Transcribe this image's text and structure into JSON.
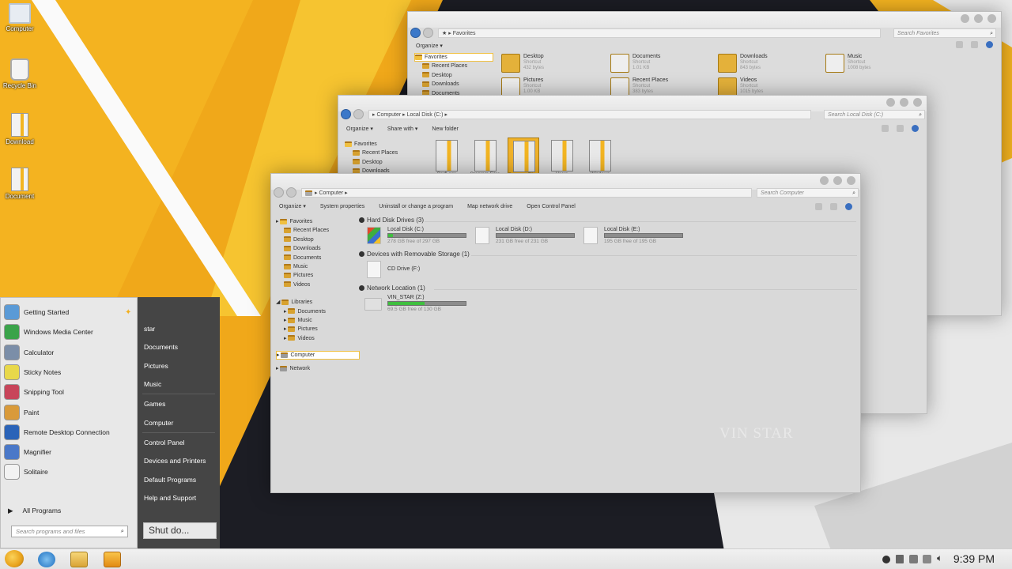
{
  "desktop_icons": [
    {
      "label": "Computer",
      "icon": "computer-icon"
    },
    {
      "label": "Recycle Bin",
      "icon": "recycle-bin-icon"
    },
    {
      "label": "Download",
      "icon": "folder-icon"
    },
    {
      "label": "Document",
      "icon": "folder-shortcut-icon"
    }
  ],
  "win_favorites": {
    "address": "Favorites",
    "search_placeholder": "Search Favorites",
    "toolbar": {
      "organize": "Organize"
    },
    "nav": [
      "Favorites",
      "Recent Places",
      "Desktop",
      "Downloads",
      "Documents"
    ],
    "items": [
      {
        "name": "Desktop",
        "type": "Shortcut",
        "size": "432 bytes"
      },
      {
        "name": "Documents",
        "type": "Shortcut",
        "size": "1.01 KB"
      },
      {
        "name": "Downloads",
        "type": "Shortcut",
        "size": "843 bytes"
      },
      {
        "name": "Music",
        "type": "Shortcut",
        "size": "1008 bytes"
      },
      {
        "name": "Pictures",
        "type": "Shortcut",
        "size": "1.00 KB"
      },
      {
        "name": "Recent Places",
        "type": "Shortcut",
        "size": "383 bytes"
      },
      {
        "name": "Videos",
        "type": "Shortcut",
        "size": "1015 bytes"
      }
    ]
  },
  "win_c": {
    "address": [
      "Computer",
      "Local Disk (C:)"
    ],
    "search_placeholder": "Search Local Disk (C:)",
    "toolbar": {
      "organize": "Organize",
      "share": "Share with",
      "new_folder": "New folder"
    },
    "nav": [
      "Favorites",
      "Recent Places",
      "Desktop",
      "Downloads"
    ],
    "folders": [
      "PerfLogs",
      "Program Files",
      "Program Files (x86)",
      "Users",
      "Windows"
    ]
  },
  "win_computer": {
    "address": "Computer",
    "search_placeholder": "Search Computer",
    "toolbar": {
      "organize": "Organize",
      "system_properties": "System properties",
      "uninstall": "Uninstall or change a program",
      "map_drive": "Map network drive",
      "control_panel": "Open Control Panel"
    },
    "nav_favorites": "Favorites",
    "nav_fav_items": [
      "Recent Places",
      "Desktop",
      "Downloads",
      "Documents",
      "Music",
      "Pictures",
      "Videos"
    ],
    "nav_libraries": "Libraries",
    "nav_lib_items": [
      "Documents",
      "Music",
      "Pictures",
      "Videos"
    ],
    "nav_computer": "Computer",
    "nav_network": "Network",
    "sections": {
      "hdd": "Hard Disk Drives (3)",
      "removable": "Devices with Removable Storage (1)",
      "network": "Network Location (1)"
    },
    "drives": [
      {
        "name": "Local Disk (C:)",
        "free": "278 GB free of 297 GB",
        "used_fraction": 0.06
      },
      {
        "name": "Local Disk (D:)",
        "free": "231 GB free of 231 GB",
        "used_fraction": 0.0
      },
      {
        "name": "Local Disk (E:)",
        "free": "195 GB free of 195 GB",
        "used_fraction": 0.0
      }
    ],
    "cd": {
      "name": "CD Drive (F:)"
    },
    "netdrive": {
      "name": "VIN_STAR (Z:)",
      "free": "69.5 GB free of 130 GB",
      "used_fraction": 0.47
    },
    "watermark": "VIN STAR"
  },
  "start_menu": {
    "programs": [
      {
        "label": "Getting Started",
        "icon": "getting-started-icon",
        "color": "#5a9ad6"
      },
      {
        "label": "Windows Media Center",
        "icon": "media-center-icon",
        "color": "#3aa34a"
      },
      {
        "label": "Calculator",
        "icon": "calculator-icon",
        "color": "#7b8ea8"
      },
      {
        "label": "Sticky Notes",
        "icon": "sticky-notes-icon",
        "color": "#e8d84a"
      },
      {
        "label": "Snipping Tool",
        "icon": "snipping-tool-icon",
        "color": "#c8455a"
      },
      {
        "label": "Paint",
        "icon": "paint-icon",
        "color": "#d99a3a"
      },
      {
        "label": "Remote Desktop Connection",
        "icon": "remote-desktop-icon",
        "color": "#2a63b8"
      },
      {
        "label": "Magnifier",
        "icon": "magnifier-icon",
        "color": "#4a78c8"
      },
      {
        "label": "Solitaire",
        "icon": "solitaire-icon",
        "color": "#f2f2f2"
      }
    ],
    "all_programs": "All Programs",
    "search_placeholder": "Search programs and files",
    "right_items": [
      "star",
      "Documents",
      "Pictures",
      "Music",
      "Games",
      "Computer",
      "Control Panel",
      "Devices and Printers",
      "Default Programs",
      "Help and Support"
    ],
    "shutdown": "Shut do..."
  },
  "taskbar": {
    "clock": "9:39 PM",
    "buttons": [
      "start-orb",
      "internet-explorer",
      "windows-explorer",
      "media-player"
    ]
  },
  "colors": {
    "accent": "#f2b01e",
    "dark": "#1d1e25",
    "window": "#dcdcdc",
    "start_right": "#454545"
  }
}
